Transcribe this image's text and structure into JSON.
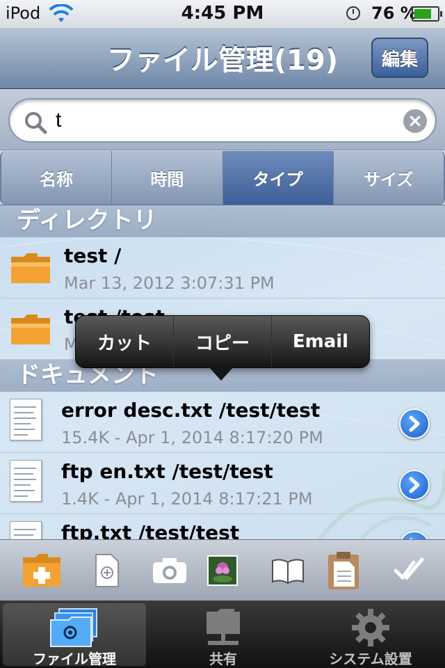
{
  "status_bar": {
    "carrier": "iPod",
    "time": "4:45 PM",
    "battery": "76 %"
  },
  "nav": {
    "title": "ファイル管理(19)",
    "edit_label": "編集"
  },
  "search": {
    "value": "t"
  },
  "sort_tabs": [
    {
      "label": "名称"
    },
    {
      "label": "時間"
    },
    {
      "label": "タイプ"
    },
    {
      "label": "サイズ"
    }
  ],
  "sections": {
    "directory": "ディレクトリ",
    "documents": "ドキュメント"
  },
  "directories": [
    {
      "title": "test /",
      "subtitle": "Mar 13, 2012 3:07:31 PM"
    },
    {
      "title": "test /test",
      "subtitle": "M"
    }
  ],
  "documents": [
    {
      "title": "error desc.txt /test/test",
      "subtitle": "15.4K - Apr 1, 2014 8:17:20 PM"
    },
    {
      "title": "ftp en.txt /test/test",
      "subtitle": "1.4K - Apr 1, 2014 8:17:21 PM"
    },
    {
      "title": "ftp.txt /test/test",
      "subtitle": ""
    }
  ],
  "popup_menu": [
    {
      "label": "カット"
    },
    {
      "label": "コピー"
    },
    {
      "label": "Email"
    }
  ],
  "toolbar_icons": [
    "new-folder-icon",
    "new-file-icon",
    "camera-icon",
    "photo-library-icon",
    "book-icon",
    "paste-icon",
    "select-all-icon"
  ],
  "tab_bar": [
    {
      "label": "ファイル管理",
      "icon": "file-manager-icon"
    },
    {
      "label": "共有",
      "icon": "share-icon"
    },
    {
      "label": "システム設置",
      "icon": "settings-icon"
    }
  ],
  "colors": {
    "nav_blue": "#6e86a6",
    "active_segment": "#3d5f98",
    "folder_orange": "#f3a233"
  }
}
